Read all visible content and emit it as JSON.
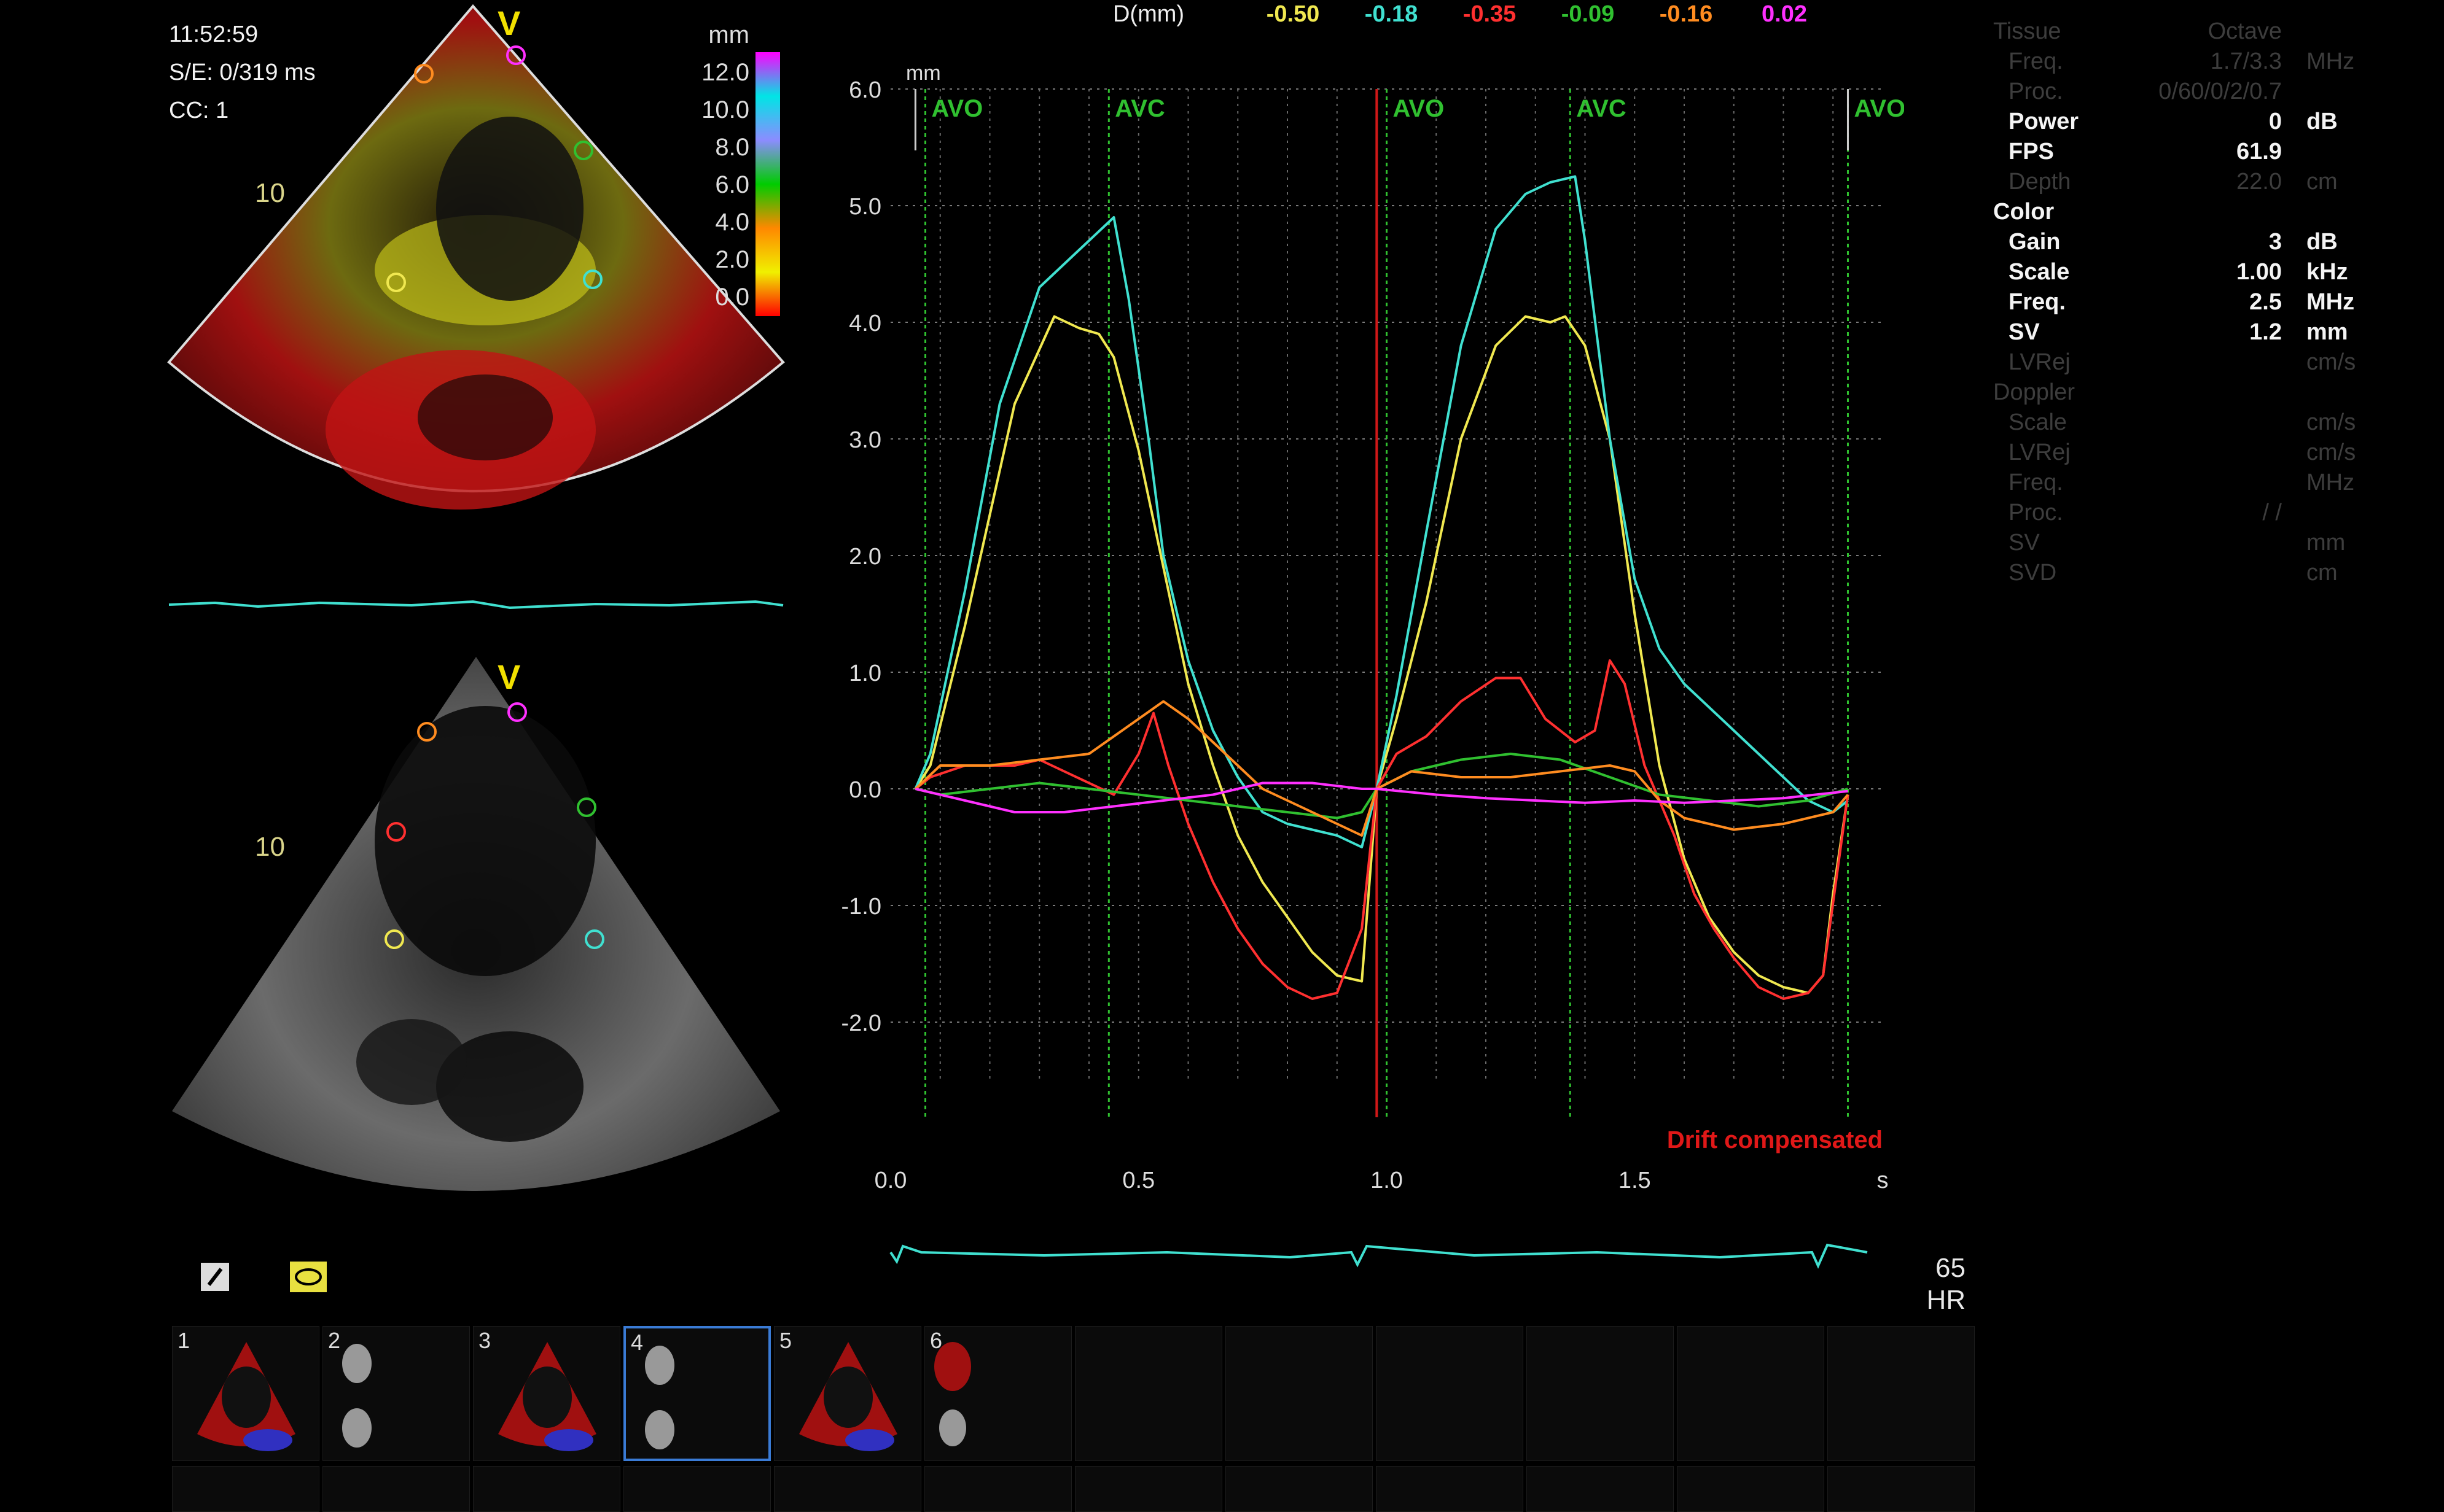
{
  "header_info": {
    "time": "11:52:59",
    "se": "S/E:  0/319 ms",
    "cc": "CC: 1"
  },
  "view_labels": {
    "v_marker": "V",
    "depth": "10"
  },
  "colorbar": {
    "unit": "mm",
    "labels": [
      "12.0",
      "10.0",
      "8.0",
      "6.0",
      "4.0",
      "2.0",
      "0.0"
    ],
    "colors": [
      "#ff00ff",
      "#00e5e5",
      "#8c8cff",
      "#00cc00",
      "#ff8800",
      "#f0f000",
      "#ff0000"
    ]
  },
  "legend": {
    "label": "D(mm)",
    "values": [
      "-0.50",
      "-0.18",
      "-0.35",
      "-0.09",
      "-0.16",
      "0.02"
    ],
    "colors": [
      "#f0e850",
      "#40e0d0",
      "#ff3030",
      "#30c030",
      "#ff8c20",
      "#ff30ff"
    ]
  },
  "chart_data": {
    "type": "line",
    "yunit": "mm",
    "xunit": "s",
    "xlim": [
      0.0,
      2.0
    ],
    "ylim": [
      -2.5,
      6.0
    ],
    "xticks": [
      "0.0",
      "0.5",
      "1.0",
      "1.5"
    ],
    "xtick_values": [
      0.0,
      0.5,
      1.0,
      1.5
    ],
    "yticks": [
      "6.0",
      "5.0",
      "4.0",
      "3.0",
      "2.0",
      "1.0",
      "0.0",
      "-1.0",
      "-2.0"
    ],
    "ytick_values": [
      6,
      5,
      4,
      3,
      2,
      1,
      0,
      -1,
      -2
    ],
    "events": [
      {
        "label": "AVO",
        "x": 0.07
      },
      {
        "label": "AVC",
        "x": 0.44
      },
      {
        "label": "AVO",
        "x": 1.0
      },
      {
        "label": "AVC",
        "x": 1.37
      },
      {
        "label": "AVO",
        "x": 1.93
      }
    ],
    "cursor_x": 0.98,
    "annotation": "Drift compensated",
    "series": [
      {
        "color": "#f0e850",
        "x": [
          0.05,
          0.08,
          0.15,
          0.25,
          0.33,
          0.38,
          0.42,
          0.45,
          0.5,
          0.55,
          0.6,
          0.65,
          0.7,
          0.75,
          0.8,
          0.85,
          0.9,
          0.95,
          0.98,
          1.02,
          1.08,
          1.15,
          1.22,
          1.28,
          1.33,
          1.36,
          1.4,
          1.45,
          1.5,
          1.55,
          1.6,
          1.65,
          1.7,
          1.75,
          1.8,
          1.85,
          1.88,
          1.9,
          1.93
        ],
        "y": [
          0.0,
          0.2,
          1.4,
          3.3,
          4.05,
          3.95,
          3.9,
          3.7,
          2.9,
          1.9,
          0.9,
          0.2,
          -0.4,
          -0.8,
          -1.1,
          -1.4,
          -1.6,
          -1.65,
          0.0,
          0.6,
          1.6,
          3.0,
          3.8,
          4.05,
          4.0,
          4.05,
          3.8,
          3.0,
          1.5,
          0.2,
          -0.6,
          -1.1,
          -1.4,
          -1.6,
          -1.7,
          -1.75,
          -1.6,
          -0.9,
          -0.05
        ]
      },
      {
        "color": "#40e0d0",
        "x": [
          0.05,
          0.08,
          0.15,
          0.22,
          0.3,
          0.35,
          0.4,
          0.45,
          0.48,
          0.52,
          0.55,
          0.6,
          0.65,
          0.7,
          0.75,
          0.8,
          0.85,
          0.9,
          0.95,
          0.98,
          1.02,
          1.08,
          1.15,
          1.22,
          1.28,
          1.33,
          1.38,
          1.4,
          1.45,
          1.5,
          1.55,
          1.6,
          1.65,
          1.7,
          1.75,
          1.8,
          1.85,
          1.9,
          1.93
        ],
        "y": [
          0.0,
          0.3,
          1.7,
          3.3,
          4.3,
          4.5,
          4.7,
          4.9,
          4.2,
          3.0,
          2.0,
          1.1,
          0.5,
          0.1,
          -0.2,
          -0.3,
          -0.35,
          -0.4,
          -0.5,
          0.0,
          0.8,
          2.2,
          3.8,
          4.8,
          5.1,
          5.2,
          5.25,
          4.7,
          3.0,
          1.8,
          1.2,
          0.9,
          0.7,
          0.5,
          0.3,
          0.1,
          -0.1,
          -0.2,
          -0.1
        ]
      },
      {
        "color": "#ff3030",
        "x": [
          0.05,
          0.08,
          0.15,
          0.25,
          0.3,
          0.35,
          0.4,
          0.45,
          0.5,
          0.53,
          0.56,
          0.6,
          0.65,
          0.7,
          0.75,
          0.8,
          0.85,
          0.9,
          0.95,
          0.98,
          1.02,
          1.08,
          1.15,
          1.22,
          1.27,
          1.32,
          1.38,
          1.42,
          1.45,
          1.48,
          1.52,
          1.58,
          1.62,
          1.66,
          1.7,
          1.75,
          1.8,
          1.85,
          1.88,
          1.93
        ],
        "y": [
          0.0,
          0.1,
          0.2,
          0.2,
          0.25,
          0.15,
          0.05,
          -0.05,
          0.3,
          0.65,
          0.2,
          -0.3,
          -0.8,
          -1.2,
          -1.5,
          -1.7,
          -1.8,
          -1.75,
          -1.2,
          0.0,
          0.3,
          0.45,
          0.75,
          0.95,
          0.95,
          0.6,
          0.4,
          0.5,
          1.1,
          0.9,
          0.2,
          -0.4,
          -0.9,
          -1.2,
          -1.45,
          -1.7,
          -1.8,
          -1.75,
          -1.6,
          -0.05
        ]
      },
      {
        "color": "#30c030",
        "x": [
          0.05,
          0.1,
          0.2,
          0.3,
          0.4,
          0.5,
          0.6,
          0.7,
          0.8,
          0.9,
          0.95,
          0.98,
          1.05,
          1.15,
          1.25,
          1.35,
          1.45,
          1.55,
          1.65,
          1.75,
          1.85,
          1.93
        ],
        "y": [
          0.0,
          -0.05,
          0.0,
          0.05,
          0.0,
          -0.05,
          -0.1,
          -0.15,
          -0.2,
          -0.25,
          -0.2,
          0.0,
          0.15,
          0.25,
          0.3,
          0.25,
          0.1,
          -0.05,
          -0.1,
          -0.15,
          -0.1,
          0.0
        ]
      },
      {
        "color": "#ff8c20",
        "x": [
          0.05,
          0.1,
          0.2,
          0.3,
          0.4,
          0.45,
          0.5,
          0.55,
          0.6,
          0.65,
          0.7,
          0.75,
          0.8,
          0.85,
          0.9,
          0.95,
          0.98,
          1.05,
          1.15,
          1.25,
          1.35,
          1.45,
          1.5,
          1.55,
          1.6,
          1.7,
          1.8,
          1.9,
          1.93
        ],
        "y": [
          0.0,
          0.2,
          0.2,
          0.25,
          0.3,
          0.45,
          0.6,
          0.75,
          0.6,
          0.4,
          0.2,
          0.0,
          -0.1,
          -0.2,
          -0.3,
          -0.4,
          0.0,
          0.15,
          0.1,
          0.1,
          0.15,
          0.2,
          0.15,
          -0.1,
          -0.25,
          -0.35,
          -0.3,
          -0.2,
          -0.05
        ]
      },
      {
        "color": "#ff30ff",
        "x": [
          0.05,
          0.15,
          0.25,
          0.35,
          0.45,
          0.55,
          0.65,
          0.75,
          0.85,
          0.95,
          0.98,
          1.1,
          1.2,
          1.3,
          1.4,
          1.5,
          1.6,
          1.7,
          1.8,
          1.93
        ],
        "y": [
          0.0,
          -0.1,
          -0.2,
          -0.2,
          -0.15,
          -0.1,
          -0.05,
          0.05,
          0.05,
          0.0,
          0.0,
          -0.05,
          -0.08,
          -0.1,
          -0.12,
          -0.1,
          -0.12,
          -0.1,
          -0.08,
          -0.02
        ]
      }
    ]
  },
  "settings": [
    {
      "key": "Tissue",
      "value": "Octave",
      "unit": "",
      "style": "dim",
      "indent": 0
    },
    {
      "key": "Freq.",
      "value": "1.7/3.3",
      "unit": "MHz",
      "style": "dim",
      "indent": 1
    },
    {
      "key": "Proc.",
      "value": "0/60/0/2/0.7",
      "unit": "",
      "style": "dim",
      "indent": 1
    },
    {
      "key": "Power",
      "value": "0",
      "unit": "dB",
      "style": "bright",
      "indent": 1
    },
    {
      "key": "FPS",
      "value": "61.9",
      "unit": "",
      "style": "bright",
      "indent": 1
    },
    {
      "key": "Depth",
      "value": "22.0",
      "unit": "cm",
      "style": "dim",
      "indent": 1
    },
    {
      "key": "Color",
      "value": "",
      "unit": "",
      "style": "bright",
      "indent": 0
    },
    {
      "key": "Gain",
      "value": "3",
      "unit": "dB",
      "style": "bright",
      "indent": 1
    },
    {
      "key": "Scale",
      "value": "1.00",
      "unit": "kHz",
      "style": "bright",
      "indent": 1
    },
    {
      "key": "Freq.",
      "value": "2.5",
      "unit": "MHz",
      "style": "bright",
      "indent": 1
    },
    {
      "key": "SV",
      "value": "1.2",
      "unit": "mm",
      "style": "bright",
      "indent": 1
    },
    {
      "key": "LVRej",
      "value": "",
      "unit": "cm/s",
      "style": "dim",
      "indent": 1
    },
    {
      "key": "Doppler",
      "value": "",
      "unit": "",
      "style": "dim",
      "indent": 0
    },
    {
      "key": "Scale",
      "value": "",
      "unit": "cm/s",
      "style": "dim",
      "indent": 1
    },
    {
      "key": "LVRej",
      "value": "",
      "unit": "cm/s",
      "style": "dim",
      "indent": 1
    },
    {
      "key": "Freq.",
      "value": "",
      "unit": "MHz",
      "style": "dim",
      "indent": 1
    },
    {
      "key": "Proc.",
      "value": "/ /",
      "unit": "",
      "style": "dim",
      "indent": 1
    },
    {
      "key": "SV",
      "value": "",
      "unit": "mm",
      "style": "dim",
      "indent": 1
    },
    {
      "key": "SVD",
      "value": "",
      "unit": "cm",
      "style": "dim",
      "indent": 1
    }
  ],
  "heart_rate": {
    "value": "65",
    "label": "HR"
  },
  "thumbnails": [
    {
      "number": "1",
      "kind": "color"
    },
    {
      "number": "2",
      "kind": "gray"
    },
    {
      "number": "3",
      "kind": "color"
    },
    {
      "number": "4",
      "kind": "gray",
      "selected": true
    },
    {
      "number": "5",
      "kind": "color"
    },
    {
      "number": "6",
      "kind": "mixed"
    }
  ]
}
